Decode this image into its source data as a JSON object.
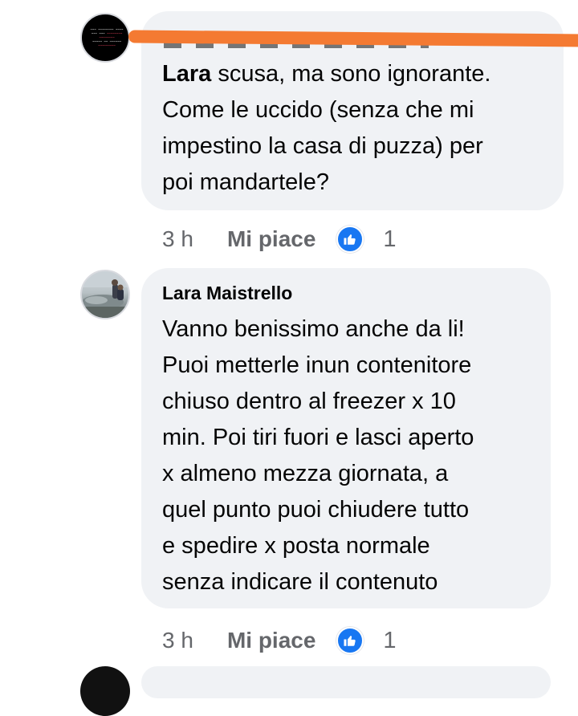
{
  "comments": [
    {
      "author": "",
      "mention": "Lara",
      "text_lines": [
        " scusa, ma sono ignorante.",
        "Come le uccido (senza che mi",
        "impestino la casa di puzza) per",
        "poi mandartele?"
      ],
      "time": "3 h",
      "like_label": "Mi piace",
      "reaction_icon": "thumbs-up-icon",
      "reaction_count": "1"
    },
    {
      "author": "Lara Maistrello",
      "text_lines": [
        "Vanno benissimo anche da li!",
        "Puoi metterle inun contenitore",
        "chiuso dentro al freezer x 10",
        "min. Poi tiri fuori e lasci aperto",
        "x almeno mezza giornata, a",
        "quel punto puoi chiudere tutto",
        "e spedire x posta normale",
        "senza indicare il contenuto"
      ],
      "time": "3 h",
      "like_label": "Mi piace",
      "reaction_icon": "thumbs-up-icon",
      "reaction_count": "1"
    }
  ],
  "colors": {
    "bubble": "#f0f2f5",
    "meta_text": "#65676b",
    "like_blue": "#1877f2",
    "redaction": "#f47a32"
  }
}
